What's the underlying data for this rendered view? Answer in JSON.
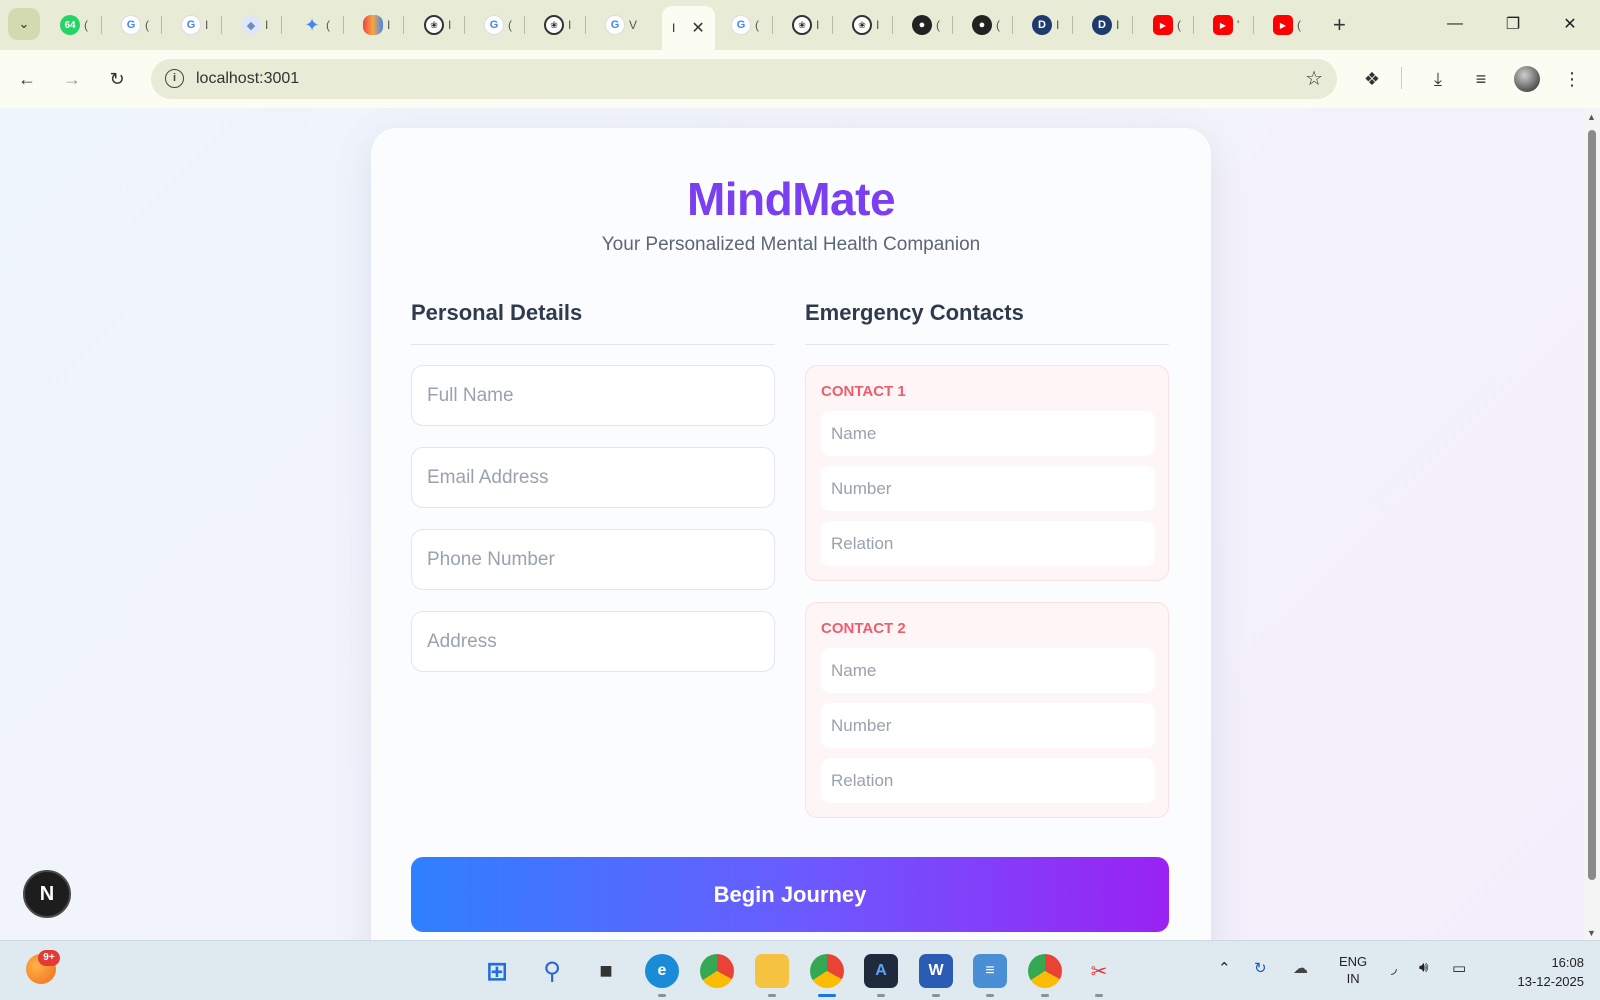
{
  "browser": {
    "tab_search_icon": "chevron-down-icon",
    "tabs": [
      {
        "icon": "whatsapp-icon",
        "badge": "64",
        "fragment": "(",
        "color": "#25d366"
      },
      {
        "icon": "google-icon",
        "fragment": "(",
        "color": "#4285f4"
      },
      {
        "icon": "google-icon",
        "fragment": "I",
        "color": "#4285f4"
      },
      {
        "icon": "shield-icon",
        "fragment": "I",
        "color": "#6b8cc9"
      },
      {
        "icon": "gemini-icon",
        "fragment": "(",
        "color": "#4285f4"
      },
      {
        "icon": "cloud-icon",
        "fragment": "I",
        "color": "#f4a742"
      },
      {
        "icon": "chatgpt-icon",
        "fragment": "I",
        "color": "#333333"
      },
      {
        "icon": "google-icon",
        "fragment": "(",
        "color": "#4285f4"
      },
      {
        "icon": "chatgpt-icon",
        "fragment": "I",
        "color": "#333333"
      },
      {
        "icon": "google-icon",
        "fragment": "V",
        "color": "#4285f4"
      }
    ],
    "active_tab": {
      "icon": "nextjs-icon",
      "fragment": "I"
    },
    "tabs_after": [
      {
        "icon": "google-icon",
        "fragment": "(",
        "color": "#4285f4"
      },
      {
        "icon": "chatgpt-icon",
        "fragment": "I",
        "color": "#333333"
      },
      {
        "icon": "chatgpt-icon",
        "fragment": "I",
        "color": "#333333"
      },
      {
        "icon": "github-icon",
        "fragment": "(",
        "color": "#222222"
      },
      {
        "icon": "github-icon",
        "fragment": "(",
        "color": "#222222"
      },
      {
        "icon": "d-icon",
        "letter": "D",
        "fragment": "I",
        "color": "#1f3b6e"
      },
      {
        "icon": "d-icon",
        "letter": "D",
        "fragment": "I",
        "color": "#1f3b6e"
      },
      {
        "icon": "youtube-icon",
        "fragment": "(",
        "color": "#ff0000"
      },
      {
        "icon": "youtube-icon",
        "fragment": "'",
        "color": "#ff0000"
      },
      {
        "icon": "youtube-icon",
        "fragment": "(",
        "color": "#ff0000"
      }
    ],
    "url": "localhost:3001"
  },
  "page": {
    "brand": "MindMate",
    "tagline": "Your Personalized Mental Health Companion",
    "personal_section": {
      "title": "Personal Details",
      "fields": [
        {
          "placeholder": "Full Name",
          "value": ""
        },
        {
          "placeholder": "Email Address",
          "value": ""
        },
        {
          "placeholder": "Phone Number",
          "value": ""
        },
        {
          "placeholder": "Address",
          "value": ""
        }
      ]
    },
    "emergency_section": {
      "title": "Emergency Contacts",
      "contacts": [
        {
          "label": "CONTACT 1",
          "name_placeholder": "Name",
          "number_placeholder": "Number",
          "relation_placeholder": "Relation"
        },
        {
          "label": "CONTACT 2",
          "name_placeholder": "Name",
          "number_placeholder": "Number",
          "relation_placeholder": "Relation"
        }
      ]
    },
    "submit_label": "Begin Journey",
    "dev_badge": "N",
    "colors": {
      "brand": "#7a3ff1",
      "contact_label": "#ef5d6d",
      "cta_start": "#2f80ff",
      "cta_end": "#9a22f3"
    }
  },
  "taskbar": {
    "weather_badge": "9+",
    "apps": [
      "windows-start-icon",
      "search-icon",
      "task-view-icon",
      "edge-icon",
      "chrome-icon",
      "file-explorer-icon",
      "chrome-icon",
      "vscode-icon",
      "word-icon",
      "notepad-icon",
      "chrome-profile-icon",
      "snipping-tool-icon"
    ],
    "language": "ENG",
    "region": "IN",
    "time": "16:08",
    "date": "13-12-2025"
  }
}
